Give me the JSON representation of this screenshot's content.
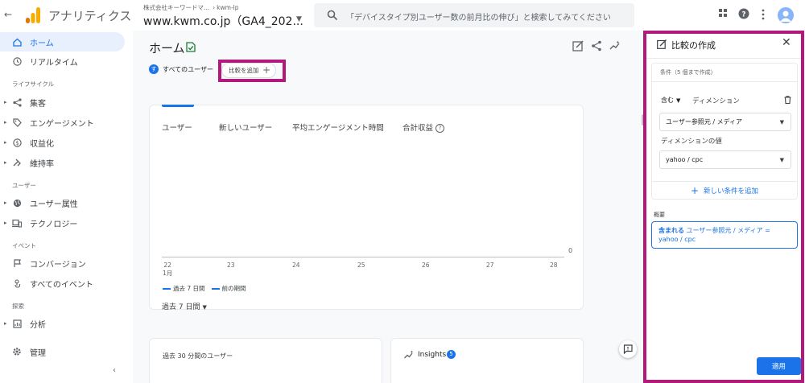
{
  "topbar": {
    "app_title": "アナリティクス",
    "account_name": "株式会社キーワードマ...",
    "breadcrumb_sep": "›",
    "account_sub": "kwm-lp",
    "property_name": "www.kwm.co.jp（GA4_202...",
    "search_placeholder": "「デバイスタイプ別ユーザー数の前月比の伸び」と検索してみてください",
    "brand_colors": {
      "logo_orange": "#f9ab00",
      "logo_dark": "#e37400"
    },
    "icons": [
      "back-arrow-icon",
      "search-icon",
      "apps-grid-icon",
      "help-icon",
      "more-vert-icon",
      "avatar"
    ]
  },
  "sidebar": {
    "items": [
      {
        "label": "ホーム",
        "icon": "home-icon",
        "active": true
      },
      {
        "label": "リアルタイム",
        "icon": "clock-icon"
      }
    ],
    "sections": [
      {
        "title": "ライフサイクル",
        "items": [
          "集客",
          "エンゲージメント",
          "収益化",
          "維持率"
        ]
      },
      {
        "title": "ユーザー",
        "items": [
          "ユーザー属性",
          "テクノロジー"
        ]
      },
      {
        "title": "イベント",
        "items": [
          "コンバージョン",
          "すべてのイベント"
        ]
      },
      {
        "title": "探索",
        "items": [
          "分析"
        ]
      }
    ],
    "admin_label": "管理"
  },
  "main": {
    "page_title": "ホーム",
    "user_segment": {
      "badge": "す",
      "label": "すべてのユーザー"
    },
    "add_compare_label": "比較を追加",
    "add_compare_plus": "+",
    "metric_tabs": [
      "ユーザー",
      "新しいユーザー",
      "平均エンゲージメント時間",
      "合計収益"
    ],
    "help_glyph": "?",
    "chart": {
      "zero_label": "0",
      "x_ticks": [
        "22",
        "23",
        "24",
        "25",
        "26",
        "27",
        "28"
      ],
      "x_month": "1月",
      "legend_current": "過去 7 日間",
      "legend_previous": "前の期間",
      "accent": "#1a73e8"
    },
    "date_range": "過去 7 日間",
    "realtime_card_label": "過去 30 分間のユーザー",
    "insights_label": "Insights",
    "insights_count": "5"
  },
  "compare_panel": {
    "title": "比較の作成",
    "conditions_caption": "条件（5 個まで作成）",
    "include_label": "含む",
    "dimension_label": "ディメンション",
    "dimension_value": "ユーザー参照元 / メディア",
    "dimension_value_label": "ディメンションの値",
    "dimension_value_selected": "yahoo / cpc",
    "add_condition": "新しい条件を追加",
    "add_condition_plus": "+",
    "summary_label": "概要",
    "summary_keyword": "含まれる",
    "summary_text": " ユーザー参照元 / メディア = yahoo / cpc",
    "apply_label": "適用",
    "highlight_color": "#b3197b"
  }
}
